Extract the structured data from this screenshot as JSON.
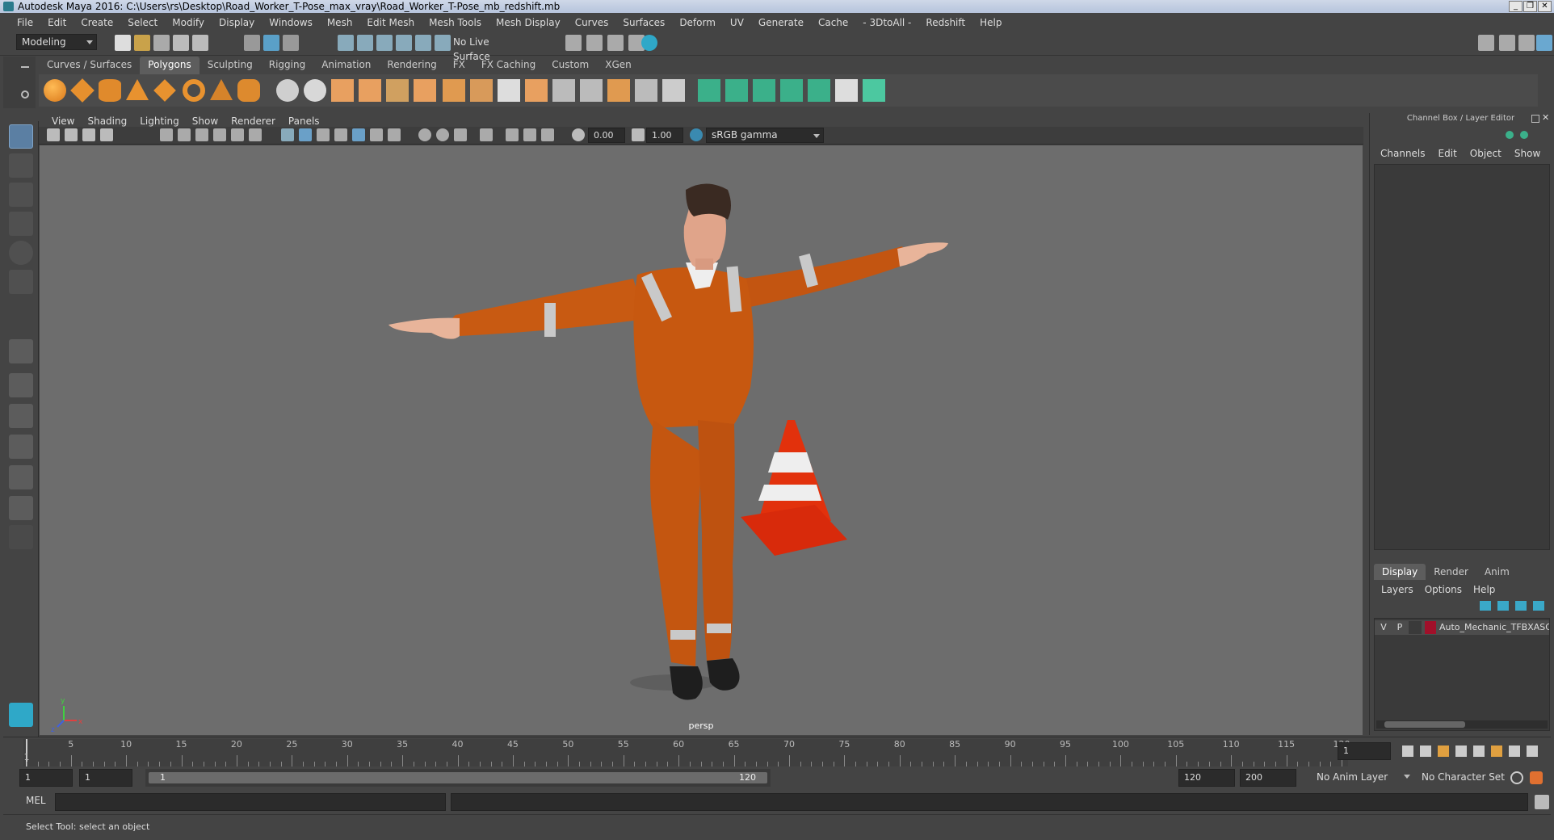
{
  "window": {
    "title": "Autodesk Maya 2016: C:\\Users\\rs\\Desktop\\Road_Worker_T-Pose_max_vray\\Road_Worker_T-Pose_mb_redshift.mb",
    "minimize": "_",
    "restore": "❐",
    "close": "✕"
  },
  "menubar": [
    "File",
    "Edit",
    "Create",
    "Select",
    "Modify",
    "Display",
    "Windows",
    "Mesh",
    "Edit Mesh",
    "Mesh Tools",
    "Mesh Display",
    "Curves",
    "Surfaces",
    "Deform",
    "UV",
    "Generate",
    "Cache",
    "- 3DtoAll -",
    "Redshift",
    "Help"
  ],
  "status_line": {
    "menuset": "Modeling",
    "live_surface": "No Live Surface"
  },
  "shelf": {
    "tabs": [
      "Curves / Surfaces",
      "Polygons",
      "Sculpting",
      "Rigging",
      "Animation",
      "Rendering",
      "FX",
      "FX Caching",
      "Custom",
      "XGen"
    ],
    "active_tab": "Polygons"
  },
  "viewport": {
    "menu": [
      "View",
      "Shading",
      "Lighting",
      "Show",
      "Renderer",
      "Panels"
    ],
    "exposure": "0.00",
    "gamma": "1.00",
    "color_space": "sRGB gamma",
    "camera": "persp",
    "axis_x": "x",
    "axis_y": "y",
    "axis_z": "z"
  },
  "channel_box": {
    "title": "Channel Box / Layer Editor",
    "menu": [
      "Channels",
      "Edit",
      "Object",
      "Show"
    ],
    "layer_tabs": [
      "Display",
      "Render",
      "Anim"
    ],
    "active_layer_tab": "Display",
    "layer_menu": [
      "Layers",
      "Options",
      "Help"
    ],
    "layer": {
      "visible": "V",
      "playback": "P",
      "name": "Auto_Mechanic_TFBXASC",
      "color": "#a0102a"
    }
  },
  "timeline": {
    "ticks": [
      "5",
      "10",
      "15",
      "20",
      "25",
      "30",
      "35",
      "40",
      "45",
      "50",
      "55",
      "60",
      "65",
      "70",
      "75",
      "80",
      "85",
      "90",
      "95",
      "100",
      "105",
      "110",
      "115",
      "120"
    ],
    "start_label": "1",
    "current_frame": "1"
  },
  "range": {
    "start": "1",
    "playback_start": "1",
    "slider_start": "1",
    "slider_end": "120",
    "playback_end": "120",
    "end": "200",
    "anim_layer": "No Anim Layer",
    "character_set": "No Character Set"
  },
  "command_line": {
    "label": "MEL"
  },
  "help_line": {
    "text": "Select Tool: select an object"
  }
}
